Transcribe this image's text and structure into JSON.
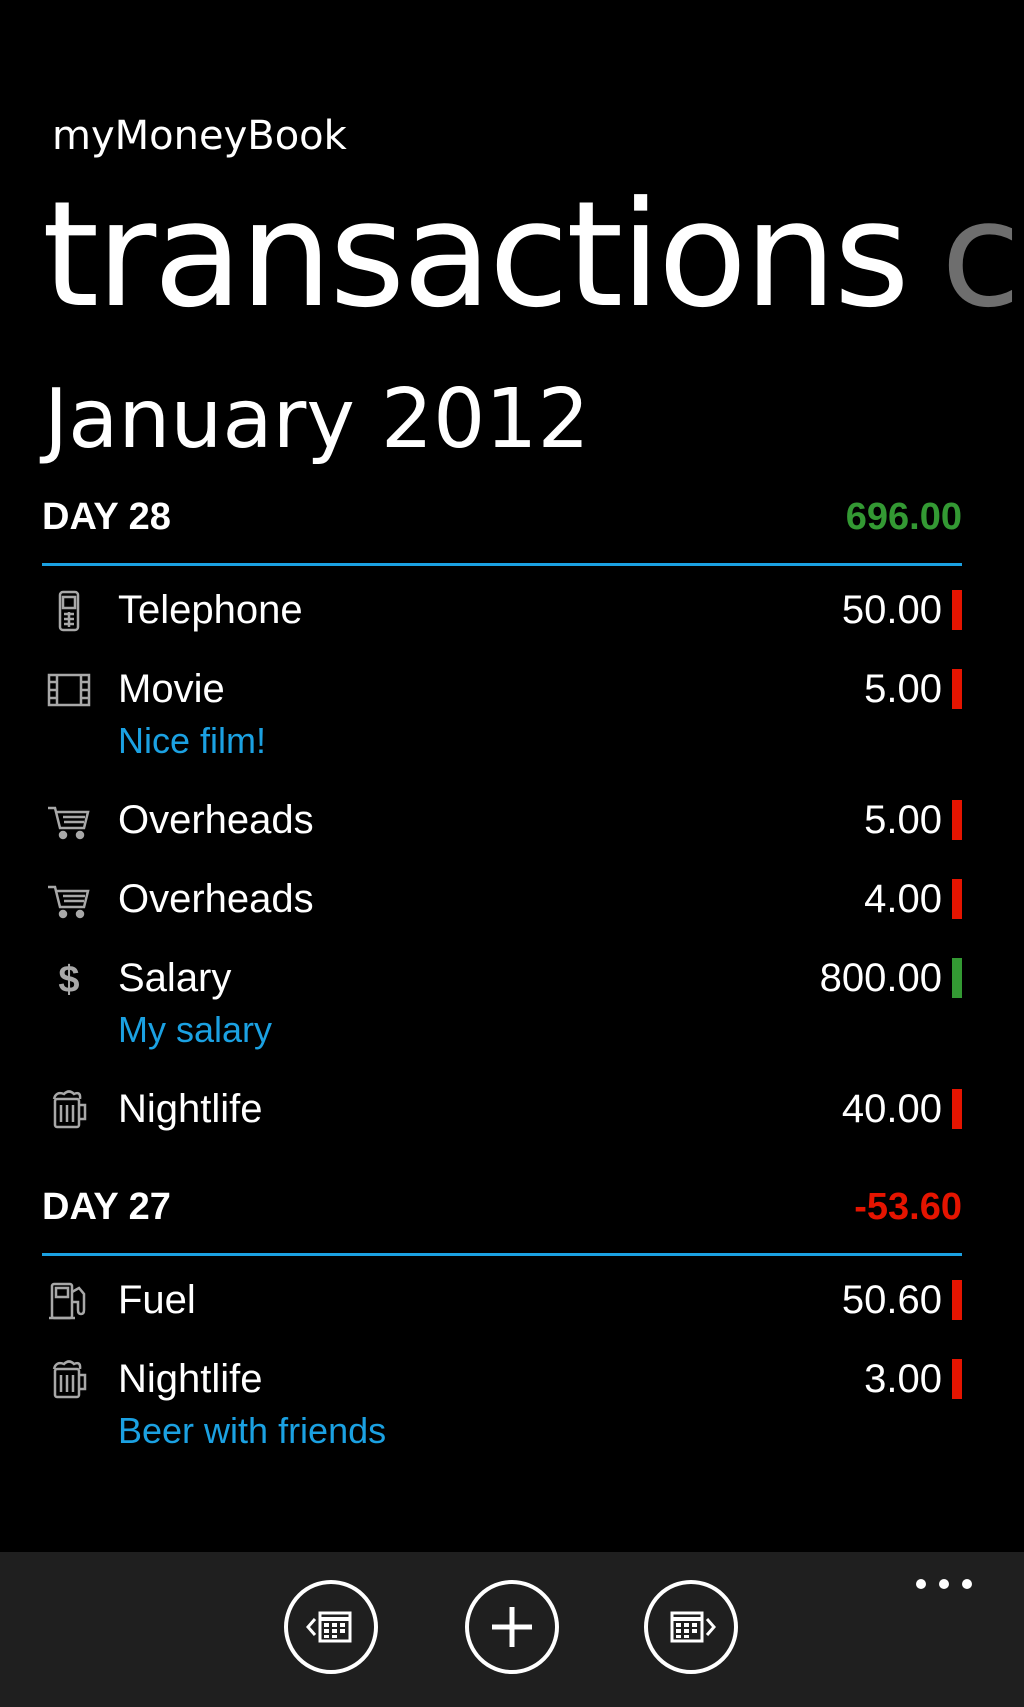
{
  "app": {
    "title": "myMoneyBook",
    "pivot_active": "transactions",
    "pivot_next": "ca",
    "month": "January 2012"
  },
  "colors": {
    "accent": "#1ba1e2",
    "expense": "#e51400",
    "income": "#339933"
  },
  "days": [
    {
      "label": "DAY 28",
      "total": "696.00",
      "total_type": "income",
      "transactions": [
        {
          "icon": "telephone-icon",
          "name": "Telephone",
          "amount": "50.00",
          "type": "expense"
        },
        {
          "icon": "film-icon",
          "name": "Movie",
          "note": "Nice film!",
          "amount": "5.00",
          "type": "expense"
        },
        {
          "icon": "cart-icon",
          "name": "Overheads",
          "amount": "5.00",
          "type": "expense"
        },
        {
          "icon": "cart-icon",
          "name": "Overheads",
          "amount": "4.00",
          "type": "expense"
        },
        {
          "icon": "dollar-icon",
          "name": "Salary",
          "note": "My salary",
          "amount": "800.00",
          "type": "income"
        },
        {
          "icon": "beer-icon",
          "name": "Nightlife",
          "amount": "40.00",
          "type": "expense"
        }
      ]
    },
    {
      "label": "DAY 27",
      "total": "-53.60",
      "total_type": "expense",
      "transactions": [
        {
          "icon": "fuel-icon",
          "name": "Fuel",
          "amount": "50.60",
          "type": "expense"
        },
        {
          "icon": "beer-icon",
          "name": "Nightlife",
          "note": "Beer with friends",
          "amount": "3.00",
          "type": "expense"
        }
      ]
    }
  ],
  "app_bar": {
    "buttons": [
      {
        "name": "previous-month-button",
        "icon": "calendar-prev-icon"
      },
      {
        "name": "add-transaction-button",
        "icon": "plus-icon"
      },
      {
        "name": "next-month-button",
        "icon": "calendar-next-icon"
      }
    ],
    "more_icon": "more-dots-icon"
  }
}
